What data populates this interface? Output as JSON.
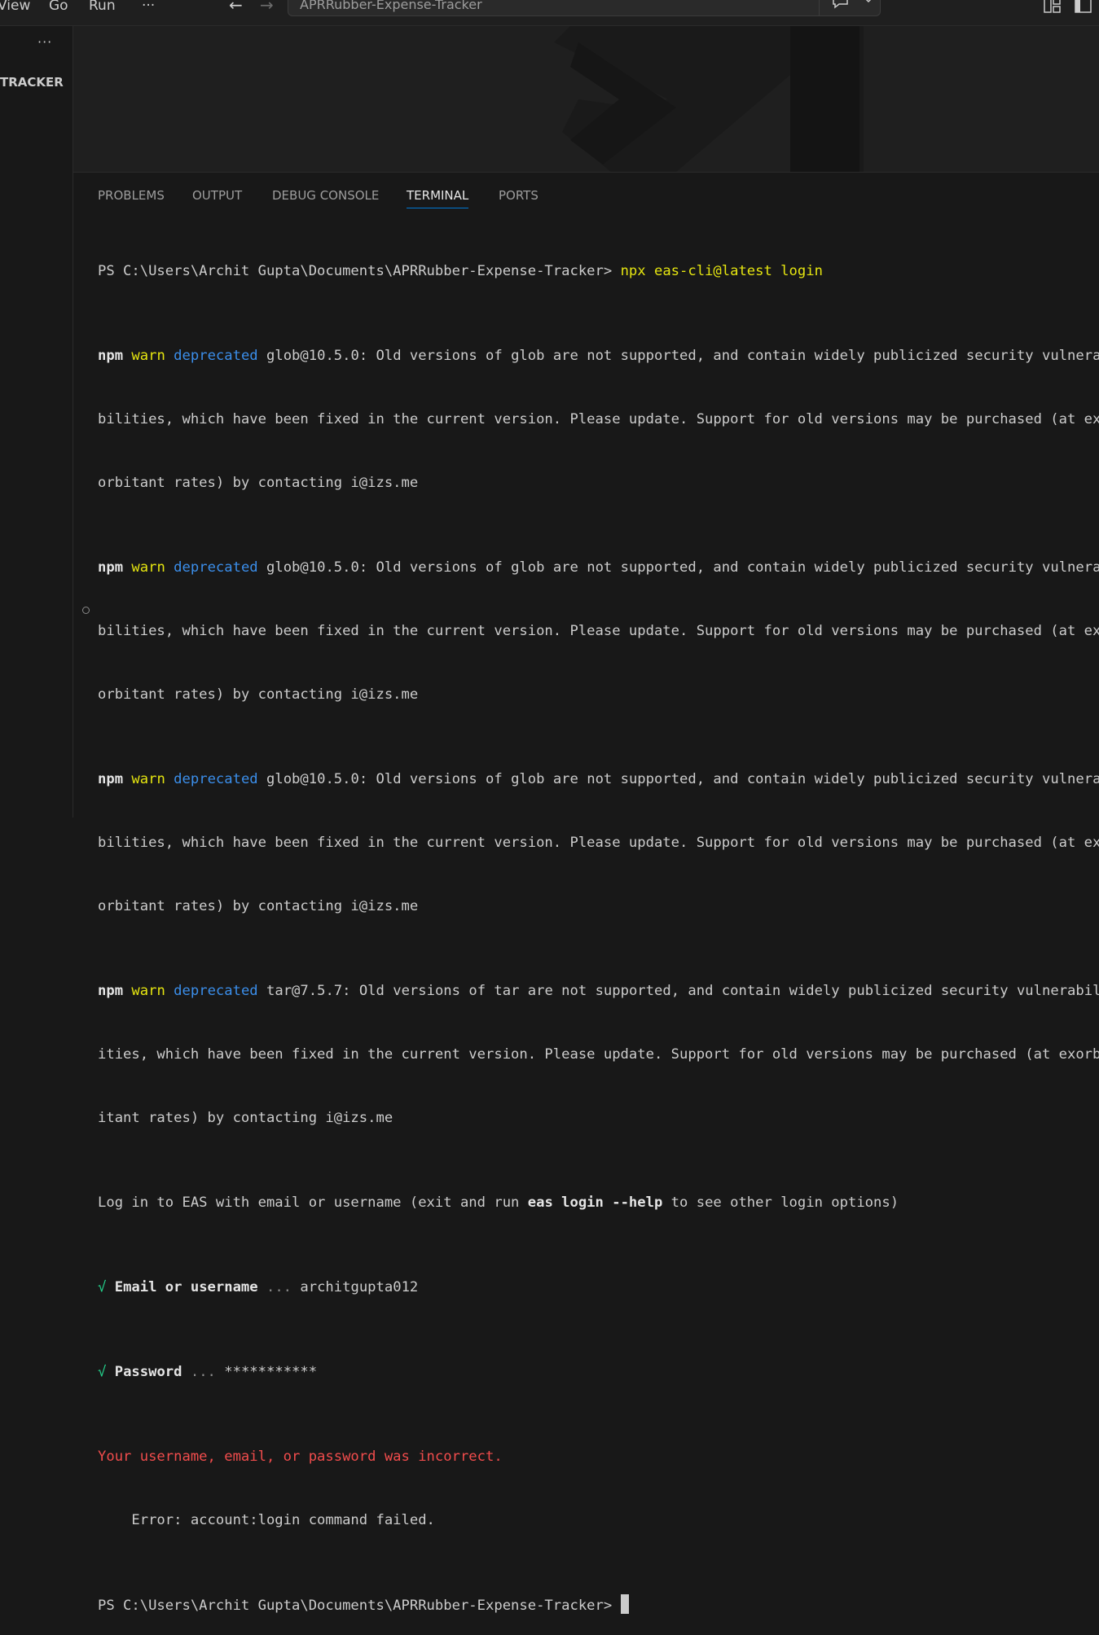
{
  "menu": {
    "view": "View",
    "go": "Go",
    "run": "Run",
    "more": "···"
  },
  "command_center": {
    "title": "APRRubber-Expense-Tracker"
  },
  "sidebar": {
    "more": "···",
    "title": "TRACKER"
  },
  "panel": {
    "tabs": [
      "PROBLEMS",
      "OUTPUT",
      "DEBUG CONSOLE",
      "TERMINAL",
      "PORTS"
    ],
    "active_tab": "TERMINAL"
  },
  "terminal": {
    "prompt": "PS C:\\Users\\Archit Gupta\\Documents\\APRRubber-Expense-Tracker>",
    "command": "npx eas-cli@latest login",
    "npm": "npm",
    "warn": "warn",
    "deprecated": "deprecated",
    "warn1": {
      "line1": " glob@10.5.0: Old versions of glob are not supported, and contain widely publicized security vulnera",
      "line2": "bilities, which have been fixed in the current version. Please update. Support for old versions may be purchased (at ex",
      "line3": "orbitant rates) by contacting i@izs.me"
    },
    "warn4": {
      "line1": " tar@7.5.7: Old versions of tar are not supported, and contain widely publicized security vulnerabil",
      "line2": "ities, which have been fixed in the current version. Please update. Support for old versions may be purchased (at exorb",
      "line3": "itant rates) by contacting i@izs.me"
    },
    "login_pre": "Log in to EAS with email or username (exit and run ",
    "login_cmd": "eas login --help",
    "login_post": " to see other login options)",
    "check": "√",
    "email_label": "Email or username",
    "email_dots": " ... ",
    "email_value": "architgupta012",
    "password_label": "Password",
    "password_dots": " ... ",
    "password_value": "***********",
    "error1": "Your username, email, or password was incorrect.",
    "error2": "    Error: account:login command failed.",
    "final_prompt": "PS C:\\Users\\Archit Gupta\\Documents\\APRRubber-Expense-Tracker> "
  },
  "colors": {
    "yellow": "#e5e510",
    "blue": "#3b8eea",
    "red": "#f14c4c",
    "accent": "#0078d4"
  }
}
